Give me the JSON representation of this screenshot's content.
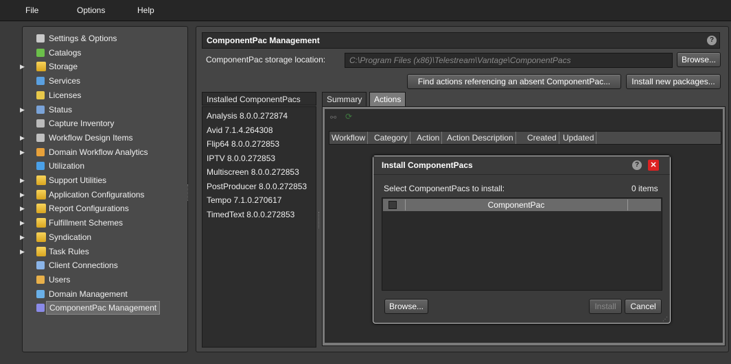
{
  "menu": [
    "File",
    "Options",
    "Help"
  ],
  "sidebar": {
    "items": [
      {
        "label": "Settings & Options",
        "icon": "settings-icon",
        "expandable": false
      },
      {
        "label": "Catalogs",
        "icon": "catalogs-icon",
        "expandable": false
      },
      {
        "label": "Storage",
        "icon": "folder-icon",
        "expandable": true
      },
      {
        "label": "Services",
        "icon": "services-icon",
        "expandable": false
      },
      {
        "label": "Licenses",
        "icon": "key-icon",
        "expandable": false
      },
      {
        "label": "Status",
        "icon": "status-icon",
        "expandable": true
      },
      {
        "label": "Capture Inventory",
        "icon": "capture-icon",
        "expandable": false
      },
      {
        "label": "Workflow Design Items",
        "icon": "workflow-icon",
        "expandable": true
      },
      {
        "label": "Domain Workflow Analytics",
        "icon": "analytics-icon",
        "expandable": true
      },
      {
        "label": "Utilization",
        "icon": "utilization-icon",
        "expandable": false
      },
      {
        "label": "Support Utilities",
        "icon": "folder-icon",
        "expandable": true
      },
      {
        "label": "Application Configurations",
        "icon": "folder-icon",
        "expandable": true
      },
      {
        "label": "Report Configurations",
        "icon": "folder-icon",
        "expandable": true
      },
      {
        "label": "Fulfillment Schemes",
        "icon": "folder-icon",
        "expandable": true
      },
      {
        "label": "Syndication",
        "icon": "folder-icon",
        "expandable": true
      },
      {
        "label": "Task Rules",
        "icon": "folder-icon",
        "expandable": true
      },
      {
        "label": "Client Connections",
        "icon": "client-connections-icon",
        "expandable": false
      },
      {
        "label": "Users",
        "icon": "users-icon",
        "expandable": false
      },
      {
        "label": "Domain Management",
        "icon": "domain-icon",
        "expandable": false
      },
      {
        "label": "ComponentPac Management",
        "icon": "componentpac-icon",
        "expandable": false,
        "selected": true
      }
    ]
  },
  "main": {
    "title": "ComponentPac Management",
    "help": "?",
    "storage_label": "ComponentPac storage location:",
    "storage_path": "C:\\Program Files (x86)\\Telestream\\Vantage\\ComponentPacs",
    "browse_label": "Browse...",
    "find_actions_label": "Find actions referencing an absent ComponentPac...",
    "install_new_label": "Install new packages...",
    "installed_header": "Installed ComponentPacs",
    "installed": [
      "Analysis 8.0.0.272874",
      "Avid 7.1.4.264308",
      "Flip64 8.0.0.272853",
      "IPTV 8.0.0.272853",
      "Multiscreen 8.0.0.272853",
      "PostProducer 8.0.0.272853",
      "Tempo 7.1.0.270617",
      "TimedText 8.0.0.272853"
    ],
    "tabs": [
      "Summary",
      "Actions"
    ],
    "active_tab": "Actions",
    "columns": [
      "Workflow",
      "Category",
      "Action",
      "Action Description",
      "Created",
      "Updated"
    ]
  },
  "dialog": {
    "title": "Install ComponentPacs",
    "help": "?",
    "close": "✕",
    "select_label": "Select ComponentPacs to install:",
    "count": "0 items",
    "column": "ComponentPac",
    "browse_label": "Browse...",
    "install_label": "Install",
    "cancel_label": "Cancel"
  }
}
